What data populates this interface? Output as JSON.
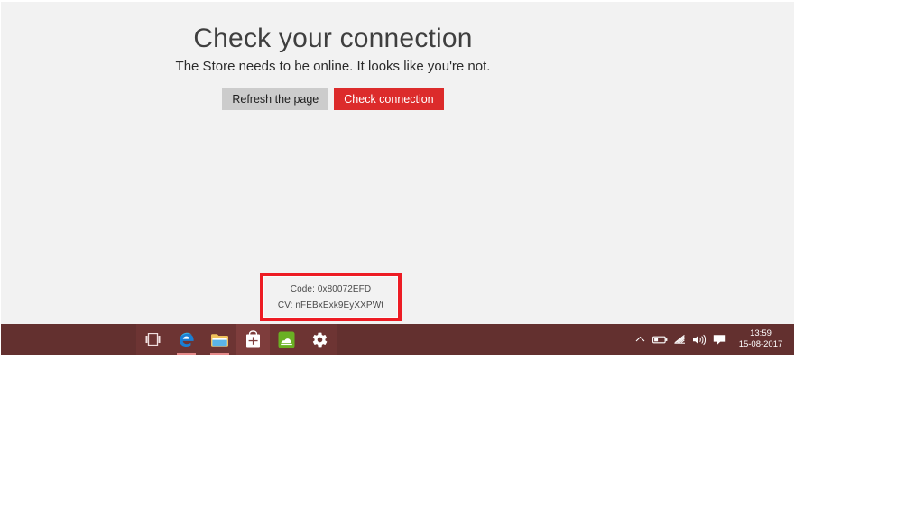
{
  "app": {
    "name": "Microsoft Store",
    "background_color": "#f2f2f2"
  },
  "error_page": {
    "heading": "Check your connection",
    "subtext": "The Store needs to be online. It looks like you're not.",
    "buttons": [
      {
        "label": "Refresh the page",
        "style": "secondary"
      },
      {
        "label": "Check connection",
        "style": "primary"
      }
    ],
    "details": {
      "code_line": "Code: 0x80072EFD",
      "cv_line": "CV: nFEBxExk9EyXXPWt",
      "annotation_color": "#ed1c24"
    }
  },
  "taskbar": {
    "background_color": "#63302f",
    "items": [
      {
        "name": "task-view",
        "icon": "task-view-icon",
        "label": "Task View",
        "state": "idle"
      },
      {
        "name": "edge",
        "icon": "edge-icon",
        "label": "Microsoft Edge",
        "state": "open"
      },
      {
        "name": "file-explorer",
        "icon": "folder-icon",
        "label": "File Explorer",
        "state": "open"
      },
      {
        "name": "store",
        "icon": "store-icon",
        "label": "Store",
        "state": "active"
      },
      {
        "name": "green-app",
        "icon": "cloud-app-icon",
        "label": "App",
        "state": "idle"
      },
      {
        "name": "settings",
        "icon": "gear-icon",
        "label": "Settings",
        "state": "idle"
      }
    ],
    "tray": {
      "icons": [
        {
          "name": "show-hidden-icons",
          "icon": "chevron-up-icon"
        },
        {
          "name": "battery",
          "icon": "battery-icon"
        },
        {
          "name": "network",
          "icon": "wifi-icon"
        },
        {
          "name": "volume",
          "icon": "speaker-icon"
        },
        {
          "name": "action-center",
          "icon": "action-center-icon"
        }
      ],
      "clock": {
        "time": "13:59",
        "date": "15-08-2017"
      }
    }
  }
}
